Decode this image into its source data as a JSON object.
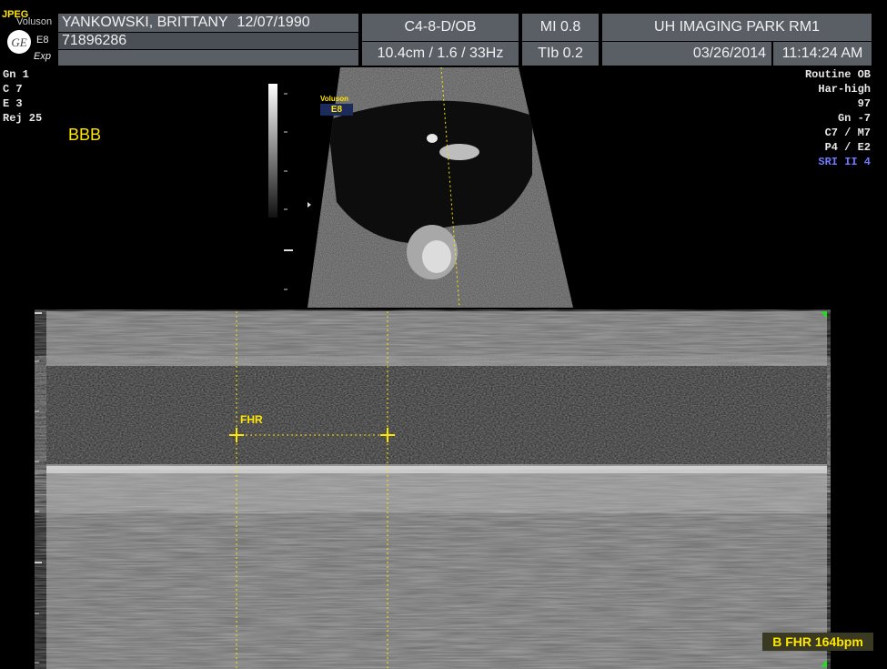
{
  "header": {
    "jpeg_tag": "JPEG",
    "vendor": "Voluson",
    "model": "E8",
    "mode": "Exp",
    "patient_name": "YANKOWSKI, BRITTANY",
    "dob": "12/07/1990",
    "patient_id": "71896286",
    "probe": "C4-8-D/OB",
    "depth_info": "10.4cm / 1.6 / 33Hz",
    "mi": "MI  0.8",
    "tib": "TIb  0.2",
    "facility": "UH IMAGING PARK RM1",
    "date": "03/26/2014",
    "time": "11:14:24 AM"
  },
  "left_params": [
    "Gn   1",
    "C   7",
    "E   3",
    "Rej  25"
  ],
  "right_params": [
    "Routine OB",
    "Har-high",
    "97",
    "Gn  -7",
    "C7 / M7",
    "P4 / E2",
    "SRI II 4"
  ],
  "overlay": {
    "bbb": "BBB",
    "voluson_tag": "Voluson",
    "e8_tag": "E8",
    "fhr_label": "FHR",
    "fhr_result": "B FHR 164bpm"
  },
  "colors": {
    "header_bg": "#5a5f66",
    "annotation": "#ffe600",
    "sri": "#6f7bff"
  }
}
